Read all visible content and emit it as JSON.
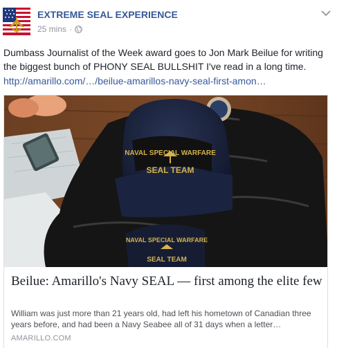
{
  "post": {
    "page_name": "EXTREME SEAL EXPERIENCE",
    "timestamp": "25 mins",
    "separator": "·",
    "text": "Dumbass Journalist of the Week award goes to Jon Mark Beilue for writing the biggest bunch of PHONY SEAL BULLSHIT I've read in a long time.",
    "link": "http://amarillo.com/…/beilue-amarillos-navy-seal-first-amon…",
    "icons": {
      "avatar": "flag-seal-avatar",
      "privacy": "globe-icon",
      "menu": "chevron-down-icon"
    }
  },
  "card": {
    "title": "Beilue: Amarillo's Navy SEAL — first among the elite few",
    "description": "William was just more than 21 years old, had left his hometown of Canadian three years before, and had been a Navy Seabee all of 31 days when a letter…",
    "domain": "AMARILLO.COM",
    "image": {
      "cap_text_top": "NAVAL SPECIAL WARFARE",
      "cap_text_bottom": "SEAL TEAM",
      "patch_text_top": "NAVAL SPECIAL WARFARE",
      "patch_text_bottom": "SEAL TEAM"
    }
  },
  "colors": {
    "link": "#365899",
    "meta": "#90949c",
    "text": "#1d2129",
    "border": "#dddfe2"
  }
}
